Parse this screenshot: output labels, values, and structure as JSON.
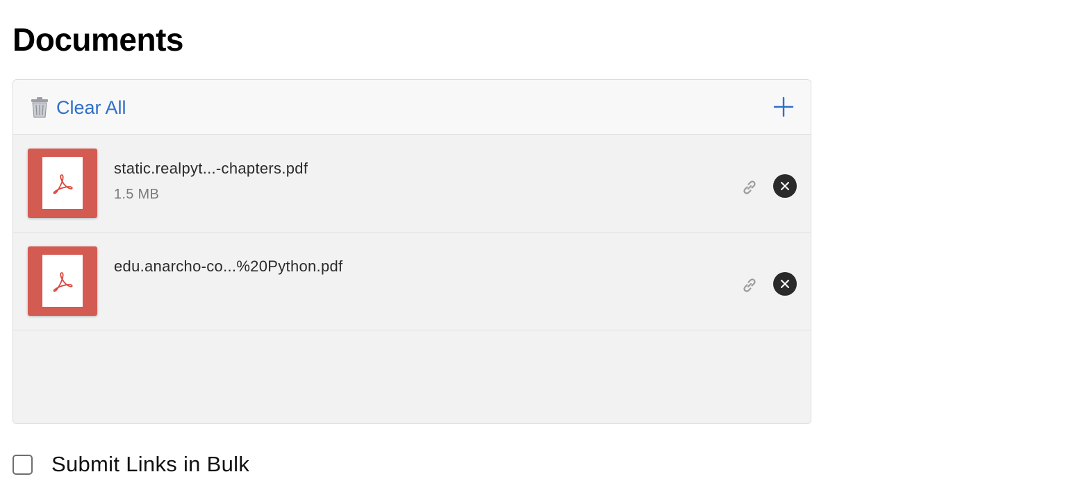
{
  "page": {
    "title": "Documents"
  },
  "toolbar": {
    "clear_all_label": "Clear All",
    "clear_all_icon": "trash-icon",
    "add_icon": "plus-icon",
    "accent_color": "#2f6fcb"
  },
  "files": [
    {
      "name": "static.realpyt...-chapters.pdf",
      "size": "1.5 MB",
      "type_icon": "pdf-icon",
      "link_icon": "link-icon",
      "remove_icon": "close-icon"
    },
    {
      "name": "edu.anarcho-co...%20Python.pdf",
      "size": "",
      "type_icon": "pdf-icon",
      "link_icon": "link-icon",
      "remove_icon": "close-icon"
    }
  ],
  "bulk": {
    "label": "Submit Links in Bulk",
    "checked": false
  },
  "colors": {
    "pdf_thumb": "#d45b52",
    "panel_bg": "#f2f2f2"
  }
}
